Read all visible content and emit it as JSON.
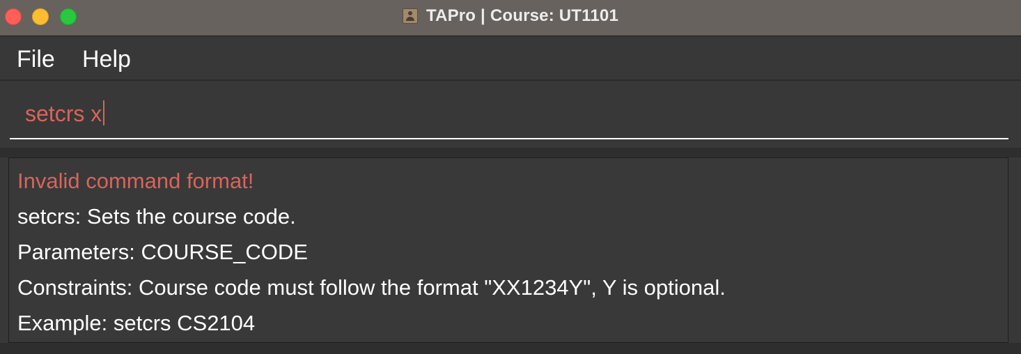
{
  "window": {
    "title": "TAPro | Course: UT1101",
    "app_icon": "contact-card-icon"
  },
  "menu": {
    "items": [
      {
        "label": "File"
      },
      {
        "label": "Help"
      }
    ]
  },
  "command_box": {
    "value": "setcrs x",
    "text_color": "#d9645b"
  },
  "result_display": {
    "lines": [
      {
        "text": "Invalid command format!",
        "type": "error"
      },
      {
        "text": "setcrs: Sets the course code.",
        "type": "info"
      },
      {
        "text": "Parameters: COURSE_CODE",
        "type": "info"
      },
      {
        "text": "Constraints: Course code must follow the format \"XX1234Y\", Y is optional.",
        "type": "info"
      },
      {
        "text": "Example: setcrs CS2104",
        "type": "info"
      }
    ],
    "error_color": "#d9645b"
  },
  "colors": {
    "titlebar": "#67625d",
    "background": "#383838",
    "close": "#ff5f57",
    "minimize": "#febc2e",
    "maximize": "#28c840"
  }
}
